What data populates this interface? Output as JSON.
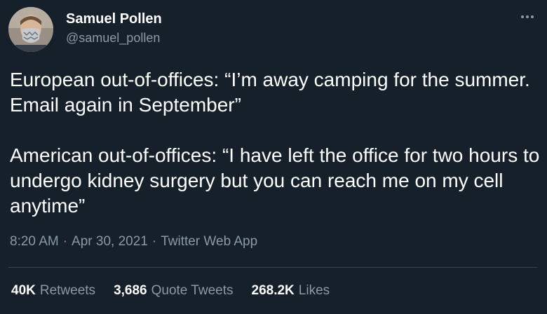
{
  "user": {
    "display_name": "Samuel Pollen",
    "handle": "@samuel_pollen"
  },
  "tweet": {
    "paragraphs": [
      "European out-of-offices: “I’m away camping for the summer. Email again in September”",
      "American out-of-offices: “I have left the office for two hours to undergo kidney surgery but you can reach me on my cell anytime”"
    ],
    "time": "8:20 AM",
    "date": "Apr 30, 2021",
    "source": "Twitter Web App",
    "separator": "·"
  },
  "stats": {
    "retweets": {
      "count": "40K",
      "label": "Retweets"
    },
    "quote_tweets": {
      "count": "3,686",
      "label": "Quote Tweets"
    },
    "likes": {
      "count": "268.2K",
      "label": "Likes"
    }
  },
  "colors": {
    "background": "#15202b",
    "text_primary": "#ffffff",
    "text_secondary": "#8b98a5",
    "divider": "#38444d"
  },
  "icons": {
    "more": "more-dots-icon"
  }
}
